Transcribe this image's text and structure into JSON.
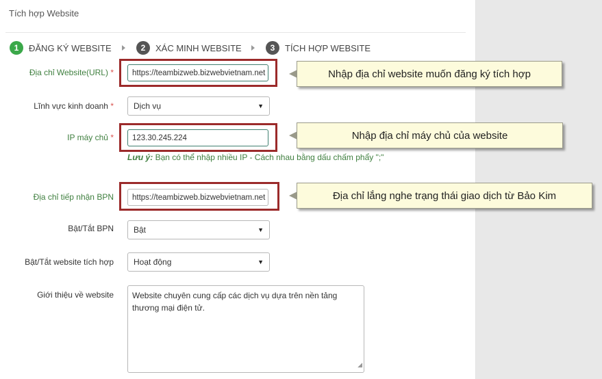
{
  "panel": {
    "title": "Tích hợp Website"
  },
  "steps": [
    {
      "number": "1",
      "label": "ĐĂNG KÝ WEBSITE"
    },
    {
      "number": "2",
      "label": "XÁC MINH WEBSITE"
    },
    {
      "number": "3",
      "label": "TÍCH HỢP WEBSITE"
    }
  ],
  "form": {
    "url": {
      "label": "Địa chỉ Website(URL)",
      "required": "*",
      "value": "https://teambizweb.bizwebvietnam.net"
    },
    "business": {
      "label": "Lĩnh vực kinh doanh",
      "required": "*",
      "value": "Dịch vụ"
    },
    "ip": {
      "label": "IP máy chủ",
      "required": "*",
      "value": "123.30.245.224"
    },
    "ip_hint": {
      "strong": "Lưu ý:",
      "text": " Bạn có thể nhập nhiều IP - Cách nhau bằng dấu chấm phẩy \";\""
    },
    "bpn_url": {
      "label": "Địa chỉ tiếp nhận BPN",
      "value": "https://teambizweb.bizwebvietnam.net"
    },
    "bpn_toggle": {
      "label": "Bật/Tắt BPN",
      "value": "Bật"
    },
    "site_toggle": {
      "label": "Bật/Tắt website tích hợp",
      "value": "Hoạt động"
    },
    "about": {
      "label": "Giới thiệu về website",
      "value": "Website chuyên cung cấp các dịch vụ dựa trên nền tảng thương mại điện tử."
    }
  },
  "callouts": {
    "url": "Nhập địa chỉ website muốn đăng ký tích hợp",
    "ip": "Nhập địa chỉ máy chủ của website",
    "bpn": "Địa chỉ lắng nghe trạng thái giao dịch từ Bảo Kim"
  },
  "colors": {
    "step_active": "#3ba84a",
    "step_inactive": "#555555",
    "highlight_border": "#9b2a2a",
    "callout_bg": "#fdfbdc",
    "label_green": "#3f7f3f"
  }
}
